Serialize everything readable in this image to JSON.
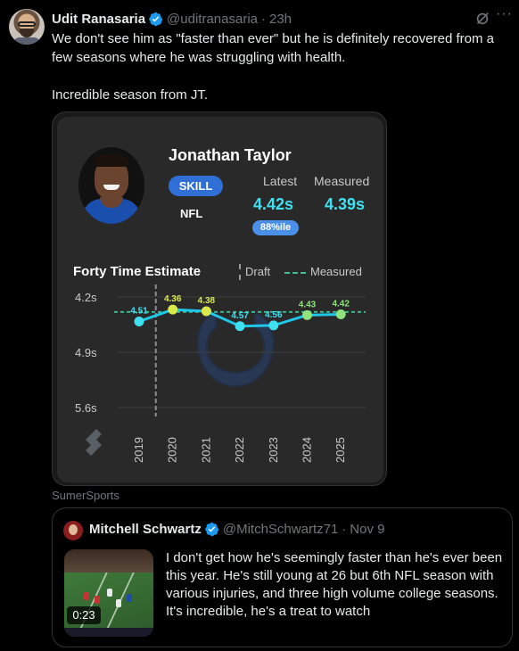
{
  "tweet": {
    "author_name": "Udit Ranasaria",
    "handle": "@uditranasaria",
    "separator": "·",
    "time": "23h",
    "more_label": "···",
    "text_lines": [
      "We don't see him as \"faster than ever\" but he is definitely recovered from a few seasons where he was struggling with health.",
      "Incredible season from JT."
    ]
  },
  "card": {
    "player_name": "Jonathan Taylor",
    "position_badge": "SKILL",
    "league": "NFL",
    "latest_label": "Latest",
    "latest_value": "4.42s",
    "percentile": "88%ile",
    "measured_label": "Measured",
    "measured_value": "4.39s",
    "chart_title": "Forty Time Estimate",
    "legend_draft": "Draft",
    "legend_measured": "Measured",
    "source": "SumerSports",
    "colors": {
      "accent_cyan": "#3fe0f2",
      "badge_blue": "#2f6fd6",
      "measured_line": "#3fbf95",
      "fast_yellow": "#d9e84a",
      "green_point": "#8fe37a"
    }
  },
  "chart_data": {
    "type": "line",
    "title": "Forty Time Estimate",
    "x": [
      "2019",
      "2020",
      "2021",
      "2022",
      "2023",
      "2024",
      "2025"
    ],
    "series": [
      {
        "name": "Forty Time Estimate",
        "values": [
          4.51,
          4.36,
          4.38,
          4.57,
          4.56,
          4.43,
          4.42
        ]
      }
    ],
    "data_labels": [
      "4.51",
      "4.36",
      "4.38",
      "4.57",
      "4.56",
      "4.43",
      "4.42"
    ],
    "point_colors": [
      "#3fe0f2",
      "#d9e84a",
      "#d9e84a",
      "#3fe0f2",
      "#3fe0f2",
      "#8fe37a",
      "#8fe37a"
    ],
    "reference_lines": [
      {
        "name": "Measured",
        "value": 4.39,
        "style": "dashed",
        "color": "#3fbf95"
      },
      {
        "name": "Draft",
        "x": "2020",
        "style": "dashed-vertical",
        "color": "#9a9a9a"
      }
    ],
    "yticks": [
      "4.2s",
      "4.9s",
      "5.6s"
    ],
    "ylim": [
      4.2,
      5.6
    ],
    "y_inverted": true,
    "grid": true,
    "legend_position": "top-right"
  },
  "quote": {
    "author_name": "Mitchell Schwartz",
    "handle": "@MitchSchwartz71",
    "separator": "·",
    "time": "Nov 9",
    "video_duration": "0:23",
    "text": "I don't get how he's seemingly faster than he's ever been this year. He's still young at 26 but 6th NFL season with various injuries, and three high volume college seasons. It's incredible, he's a treat to watch"
  }
}
